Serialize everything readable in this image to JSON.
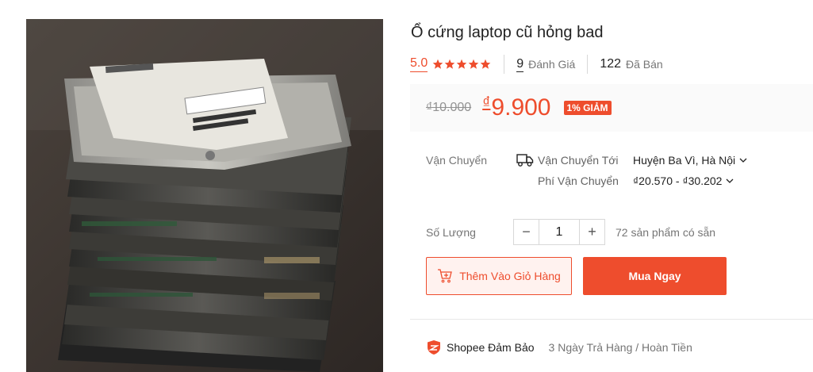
{
  "product": {
    "title": "Ổ cứng laptop cũ hỏng bad",
    "image_icon": "hard-drive-stack-photo"
  },
  "rating": {
    "score": "5.0",
    "stars": 5,
    "reviews_count": "9",
    "reviews_label": "Đánh Giá",
    "sold_count": "122",
    "sold_label": "Đã Bán"
  },
  "price": {
    "original": "₫10.000",
    "currency_symbol": "₫",
    "current": "9.900",
    "discount_badge": "1% GIẢM"
  },
  "shipping": {
    "label": "Vận Chuyển",
    "to_label": "Vận Chuyển Tới",
    "to_value": "Huyện Ba Vì, Hà Nội",
    "fee_label": "Phí Vận Chuyển",
    "fee_value": "₫20.570 - ₫30.202"
  },
  "quantity": {
    "label": "Số Lượng",
    "minus": "−",
    "value": "1",
    "plus": "+",
    "stock_text": "72 sản phẩm có sẵn"
  },
  "actions": {
    "add_to_cart": "Thêm Vào Giỏ Hàng",
    "buy_now": "Mua Ngay"
  },
  "guarantee": {
    "name": "Shopee Đảm Bảo",
    "description": "3 Ngày Trả Hàng / Hoàn Tiền"
  },
  "colors": {
    "accent": "#ee4d2d",
    "price_bg": "#fafafa",
    "cart_bg": "#fff2ef"
  }
}
